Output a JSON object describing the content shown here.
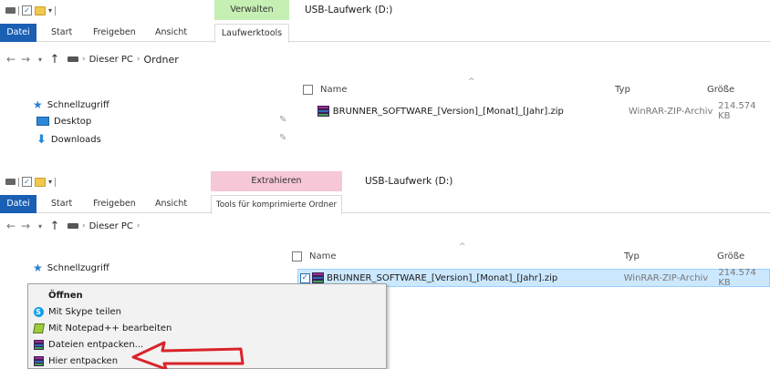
{
  "panel1": {
    "window_title": "USB-Laufwerk (D:)",
    "context_tab_label": "Verwalten",
    "context_color": "#c6efb3",
    "tabs": [
      "Datei",
      "Start",
      "Freigeben",
      "Ansicht",
      "Laufwerktools"
    ],
    "address": [
      "Dieser PC",
      "Ordner"
    ],
    "nav_items": [
      {
        "label": "Schnellzugriff",
        "icon": "star-icon"
      },
      {
        "label": "Desktop",
        "icon": "desktop-icon",
        "pinned": true
      },
      {
        "label": "Downloads",
        "icon": "download-arrow-icon",
        "pinned": true
      }
    ],
    "columns": {
      "name": "Name",
      "type": "Typ",
      "size": "Größe"
    },
    "file": {
      "name": "BRUNNER_SOFTWARE_[Version]_[Monat]_[Jahr].zip",
      "type": "WinRAR-ZIP-Archiv",
      "size": "214.574 KB"
    }
  },
  "panel2": {
    "window_title": "USB-Laufwerk (D:)",
    "context_tab_label": "Extrahieren",
    "context_color": "#f6c7d6",
    "tabs": [
      "Datei",
      "Start",
      "Freigeben",
      "Ansicht",
      "Tools für komprimierte Ordner"
    ],
    "address": [
      "Dieser PC"
    ],
    "nav_items": [
      {
        "label": "Schnellzugriff",
        "icon": "star-icon"
      }
    ],
    "columns": {
      "name": "Name",
      "type": "Typ",
      "size": "Größe"
    },
    "file": {
      "name": "BRUNNER_SOFTWARE_[Version]_[Monat]_[Jahr].zip",
      "type": "WinRAR-ZIP-Archiv",
      "size": "214.574 KB",
      "selected": true
    }
  },
  "context_menu": {
    "items": [
      {
        "label": "Öffnen",
        "bold": true,
        "icon": "none"
      },
      {
        "label": "Mit Skype teilen",
        "icon": "skype-icon"
      },
      {
        "label": "Mit Notepad++ bearbeiten",
        "icon": "notepad-plus-plus-icon"
      },
      {
        "label": "Dateien entpacken...",
        "icon": "winrar-icon"
      },
      {
        "label": "Hier entpacken",
        "icon": "winrar-icon",
        "highlighted_by_arrow": true
      }
    ]
  },
  "annotation": {
    "arrow_color": "#d9232a",
    "points_to": "Hier entpacken"
  }
}
